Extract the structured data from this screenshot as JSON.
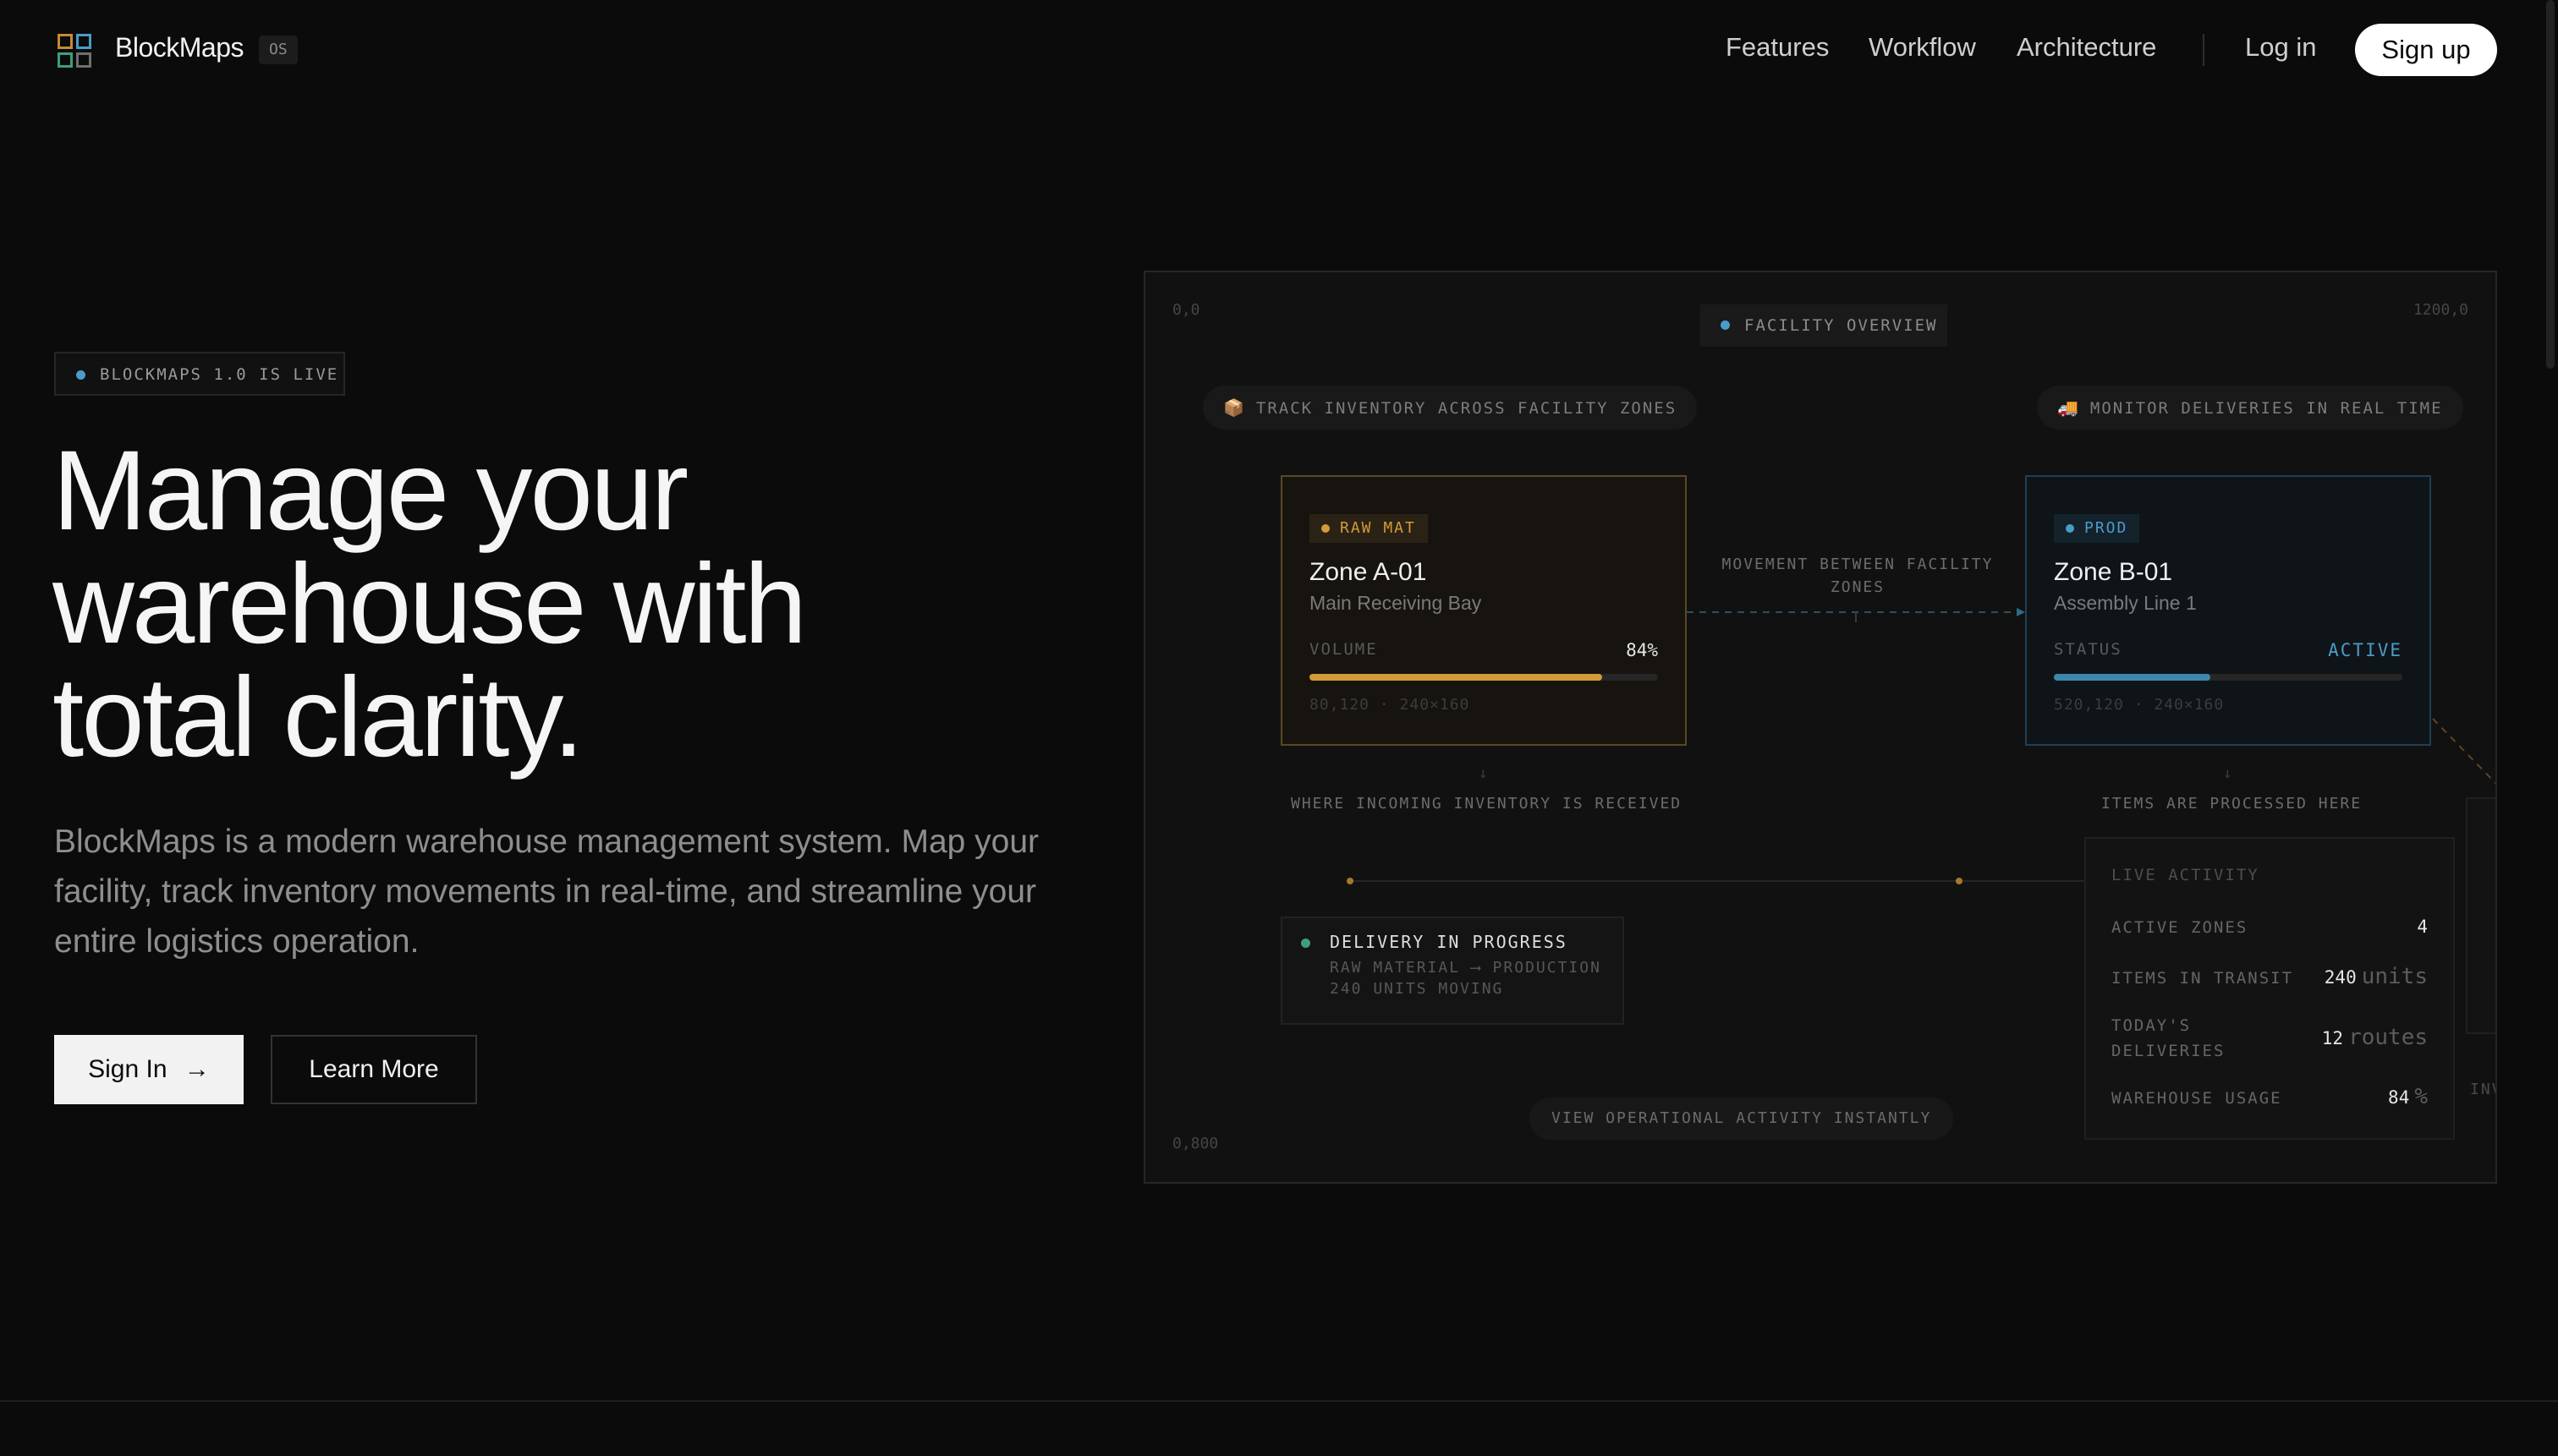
{
  "nav": {
    "brand": "BlockMaps",
    "badge": "OS",
    "links": [
      "Features",
      "Workflow",
      "Architecture"
    ],
    "login": "Log in",
    "signup": "Sign up"
  },
  "hero": {
    "badge": "BLOCKMAPS 1.0 IS LIVE",
    "headline": [
      "Manage your",
      "warehouse with",
      "total clarity."
    ],
    "sub": "BlockMaps is a modern warehouse management system. Map your facility, track inventory movements in real-time, and streamline your entire logistics operation.",
    "primary_button": "Sign In",
    "primary_button_arrow": "→",
    "secondary_button": "Learn More"
  },
  "map": {
    "corner_top_left": "0,0",
    "corner_top_right": "1200,0",
    "corner_bottom_left": "0,800",
    "title": "FACILITY OVERVIEW",
    "pill_left": "TRACK INVENTORY ACROSS FACILITY ZONES",
    "pill_left_emoji": "📦",
    "pill_right": "MONITOR DELIVERIES IN REAL TIME",
    "pill_right_emoji": "🚚",
    "zone_a": {
      "tag": "RAW MAT",
      "name": "Zone A-01",
      "location": "Main Receiving Bay",
      "metric_label": "VOLUME",
      "metric_value": "84%",
      "fill": 0.84,
      "coords": "80,120 · 240×160",
      "caption": "WHERE INCOMING INVENTORY IS RECEIVED"
    },
    "zone_b": {
      "tag": "PROD",
      "name": "Zone B-01",
      "location": "Assembly Line 1",
      "metric_label": "STATUS",
      "metric_value": "ACTIVE",
      "fill": 0.45,
      "coords": "520,120 · 240×160",
      "caption": "ITEMS ARE PROCESSED HERE"
    },
    "movement_label": "MOVEMENT BETWEEN FACILITY ZONES",
    "delivery": {
      "title": "DELIVERY IN PROGRESS",
      "route": "RAW MATERIAL ⟶ PRODUCTION",
      "units": "240 UNITS MOVING"
    },
    "live_activity": {
      "title": "LIVE ACTIVITY",
      "rows": [
        {
          "label": "ACTIVE ZONES",
          "value": "4",
          "unit": ""
        },
        {
          "label": "ITEMS IN TRANSIT",
          "value": "240",
          "unit": "units"
        },
        {
          "label": "TODAY'S DELIVERIES",
          "value": "12",
          "unit": "routes"
        },
        {
          "label": "WAREHOUSE USAGE",
          "value": "84",
          "unit": "%"
        }
      ]
    },
    "edge_label": "INV",
    "bottom_pill": "VIEW OPERATIONAL ACTIVITY INSTANTLY"
  },
  "colors": {
    "background": "#0b0b0b",
    "raw_accent": "#d39a3a",
    "prod_accent": "#4a9cc8",
    "delivery_accent": "#3f9f7b"
  }
}
